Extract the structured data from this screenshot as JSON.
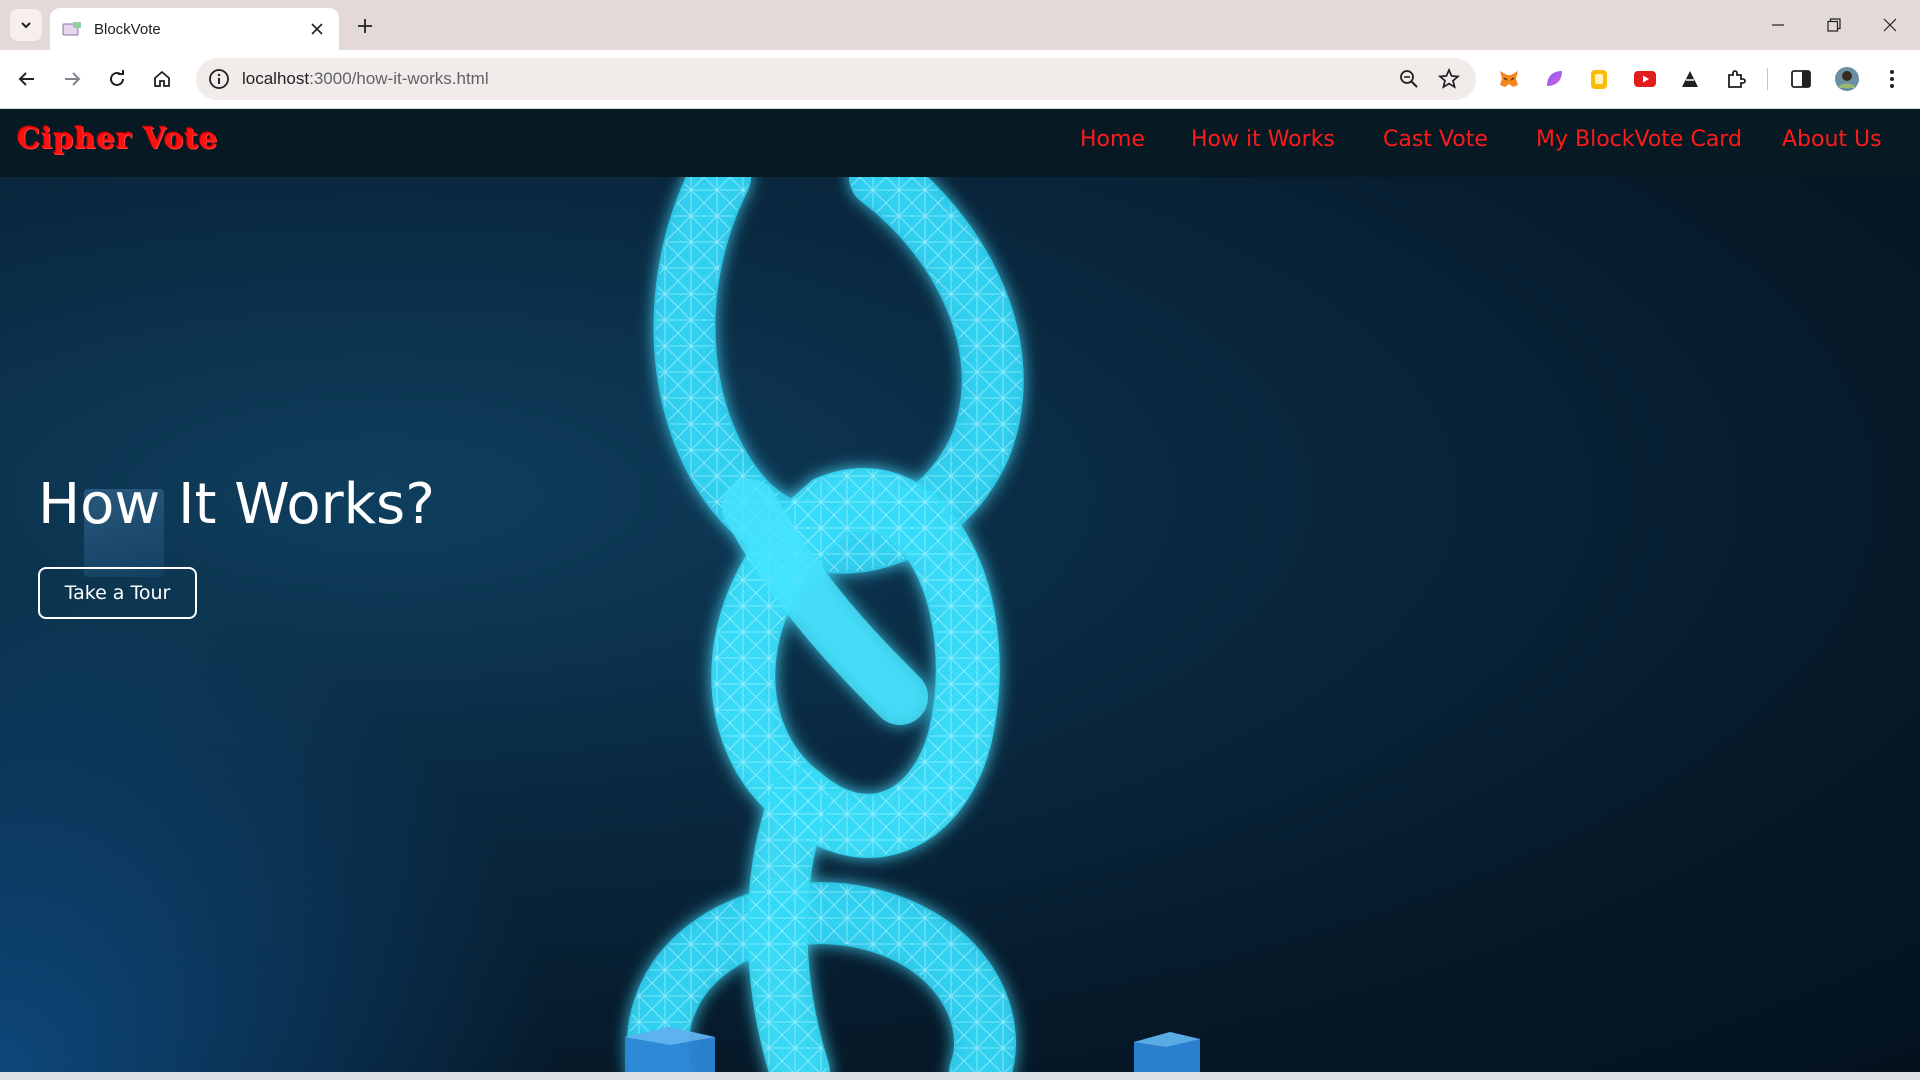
{
  "browser": {
    "tab": {
      "title": "BlockVote"
    },
    "address_bar": {
      "host": "localhost",
      "path": ":3000/how-it-works.html"
    }
  },
  "site": {
    "brand": "Cipher Vote",
    "nav": [
      {
        "label": "Home"
      },
      {
        "label": "How it Works"
      },
      {
        "label": "Cast Vote"
      },
      {
        "label": "My BlockVote Card"
      },
      {
        "label": "About Us"
      }
    ],
    "hero": {
      "title": "How It Works?",
      "button_label": "Take a Tour"
    }
  },
  "colors": {
    "nav_text": "#ff1a1a",
    "nav_bg": "#071a24",
    "chain": "#3fe0ff",
    "hero_text": "#ffffff"
  }
}
